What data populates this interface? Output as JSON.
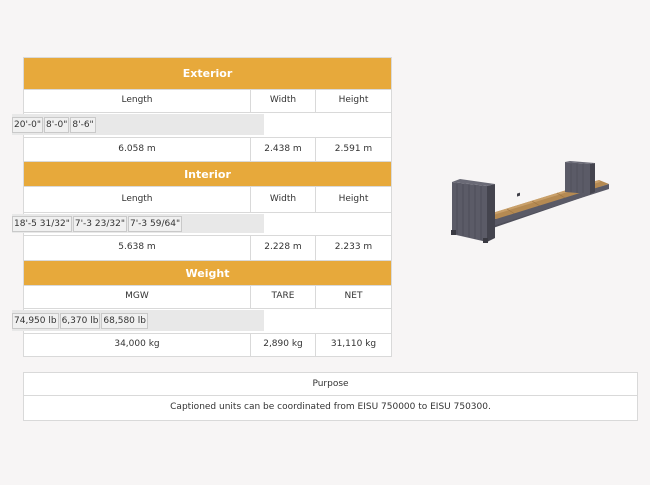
{
  "exterior": {
    "title": "Exterior",
    "headers": [
      "Length",
      "Width",
      "Height"
    ],
    "imperial": [
      "20'-0\"",
      "8'-0\"",
      "8'-6\""
    ],
    "metric": [
      "6.058 m",
      "2.438 m",
      "2.591 m"
    ]
  },
  "interior": {
    "title": "Interior",
    "headers": [
      "Length",
      "Width",
      "Height"
    ],
    "imperial": [
      "18'-5 31/32\"",
      "7'-3 23/32\"",
      "7'-3 59/64\""
    ],
    "metric": [
      "5.638 m",
      "2.228 m",
      "2.233 m"
    ]
  },
  "weight": {
    "title": "Weight",
    "headers": [
      "MGW",
      "TARE",
      "NET"
    ],
    "imperial": [
      "74,950 lb",
      "6,370 lb",
      "68,580 lb"
    ],
    "metric": [
      "34,000 kg",
      "2,890 kg",
      "31,110 kg"
    ]
  },
  "purpose": {
    "header": "Purpose",
    "text": "Captioned units can be coordinated from EISU 750000 to EISU 750300."
  },
  "colors": {
    "band": "#e7a93b",
    "border": "#d9d9d9",
    "background": "#f7f5f5"
  }
}
